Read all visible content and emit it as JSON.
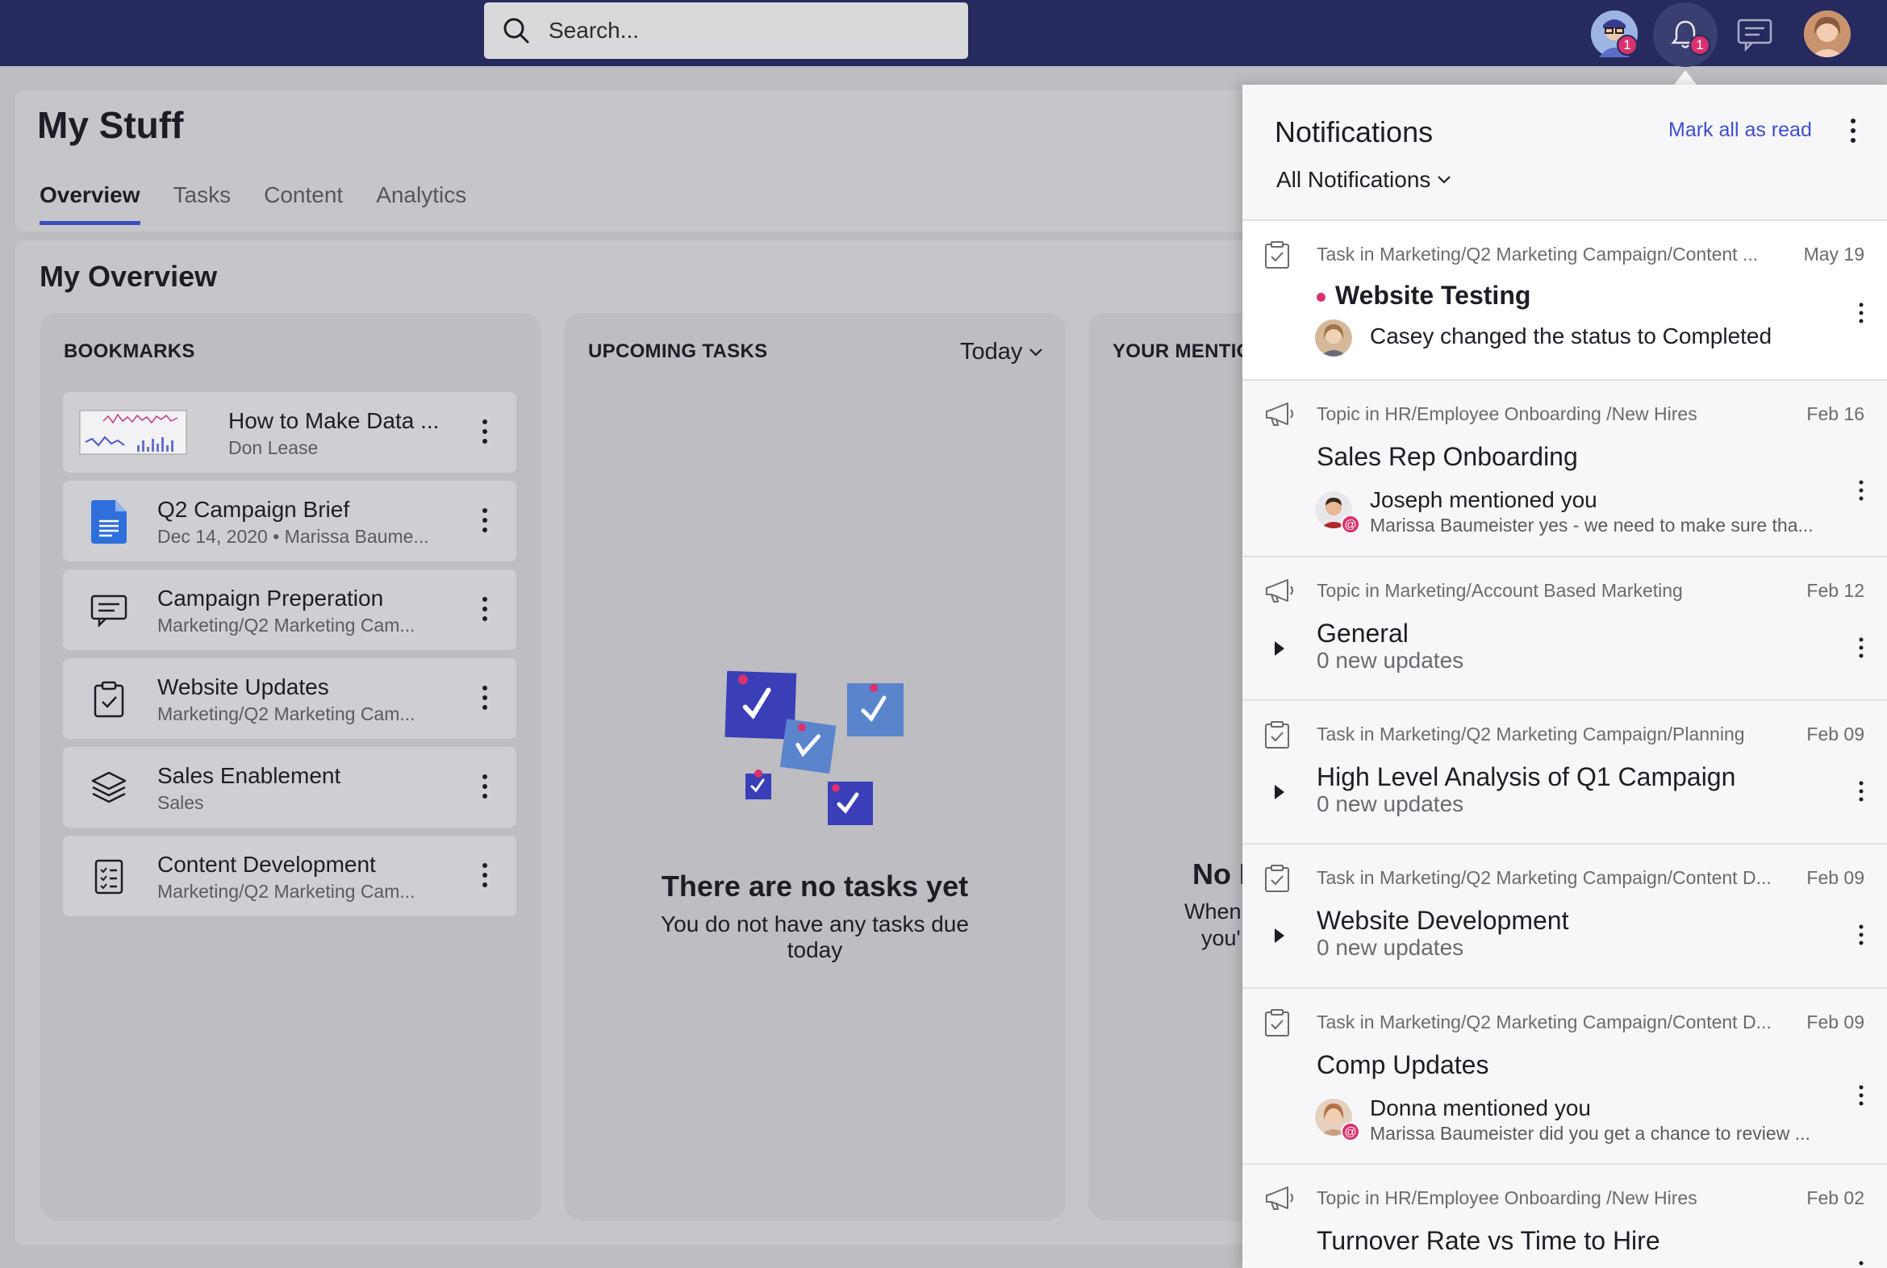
{
  "search": {
    "placeholder": "Search..."
  },
  "topbar": {
    "profile_badge": "1",
    "bell_badge": "1"
  },
  "page": {
    "title": "My Stuff",
    "tabs": [
      "Overview",
      "Tasks",
      "Content",
      "Analytics"
    ],
    "active_tab": "Overview",
    "overview_title": "My Overview"
  },
  "bookmarks": {
    "title": "BOOKMARKS",
    "items": [
      {
        "title": "How to Make Data ...",
        "subtitle": "Don Lease",
        "icon": "chart-thumbnail-icon"
      },
      {
        "title": "Q2 Campaign Brief",
        "subtitle": "Dec 14, 2020 • Marissa Baume...",
        "icon": "document-icon"
      },
      {
        "title": "Campaign Preperation",
        "subtitle": "Marketing/Q2 Marketing Cam...",
        "icon": "chat-icon"
      },
      {
        "title": "Website Updates",
        "subtitle": "Marketing/Q2 Marketing Cam...",
        "icon": "clipboard-check-icon"
      },
      {
        "title": "Sales Enablement",
        "subtitle": "Sales",
        "icon": "layers-icon"
      },
      {
        "title": "Content Development",
        "subtitle": "Marketing/Q2 Marketing Cam...",
        "icon": "checklist-icon"
      }
    ]
  },
  "tasks": {
    "title": "UPCOMING TASKS",
    "filter": "Today",
    "empty_title": "There are no tasks yet",
    "empty_sub": "You do not have any tasks due today"
  },
  "mentions": {
    "title": "YOUR MENTIO",
    "empty_title": "No I",
    "empty_line1": "When",
    "empty_line2": "you'"
  },
  "notifications": {
    "title": "Notifications",
    "mark_all": "Mark all as read",
    "filter": "All Notifications",
    "items": [
      {
        "path": "Task in Marketing/Q2 Marketing Campaign/Content ...",
        "date": "May 19",
        "title": "Website Testing",
        "line1": "Casey changed the status to Completed",
        "line2": "",
        "updates": ""
      },
      {
        "path": "Topic in HR/Employee Onboarding /New Hires",
        "date": "Feb 16",
        "title": "Sales Rep Onboarding",
        "line1": "Joseph mentioned you",
        "line2": "Marissa Baumeister yes - we need to make sure tha...",
        "updates": ""
      },
      {
        "path": "Topic in Marketing/Account Based Marketing",
        "date": "Feb 12",
        "title": "General",
        "line1": "",
        "line2": "",
        "updates": "0 new updates"
      },
      {
        "path": "Task in Marketing/Q2 Marketing Campaign/Planning",
        "date": "Feb 09",
        "title": "High Level Analysis of Q1 Campaign",
        "line1": "",
        "line2": "",
        "updates": "0 new updates"
      },
      {
        "path": "Task in Marketing/Q2 Marketing Campaign/Content D...",
        "date": "Feb 09",
        "title": "Website Development",
        "line1": "",
        "line2": "",
        "updates": "0 new updates"
      },
      {
        "path": "Task in Marketing/Q2 Marketing Campaign/Content D...",
        "date": "Feb 09",
        "title": "Comp Updates",
        "line1": "Donna mentioned you",
        "line2": "Marissa Baumeister did you get a chance to review ...",
        "updates": ""
      },
      {
        "path": "Topic in HR/Employee Onboarding /New Hires",
        "date": "Feb 02",
        "title": "Turnover Rate vs Time to Hire",
        "line1": "",
        "line2": "",
        "updates": ""
      }
    ]
  },
  "colors": {
    "topbar": "#262a5e",
    "accent": "#3d4fbf",
    "badge": "#d9326f",
    "link": "#3d4fd1"
  }
}
